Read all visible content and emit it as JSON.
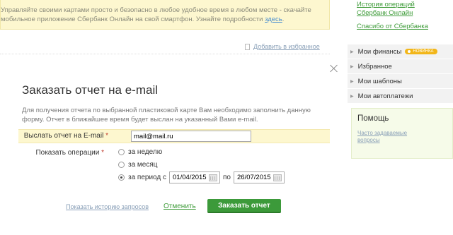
{
  "banner": {
    "line1": "Управляйте своими картами просто и безопасно в любое удобное время в любом месте - скачайте",
    "line2_text": "мобильное приложение Сбербанк Онлайн на свой смартфон. Узнайте подробности",
    "line2_link": "здесь",
    "line2_end": "."
  },
  "favorites_link": "Добавить в избранное",
  "sidebar": {
    "link1_line1": "История операций",
    "link1_line2": "Сбербанк Онлайн",
    "link2": "Спасибо от Сбербанка",
    "menu": [
      {
        "label": "Мои финансы",
        "badge": "НОВИНКА"
      },
      {
        "label": "Избранное"
      },
      {
        "label": "Мои шаблоны"
      },
      {
        "label": "Мои автоплатежи"
      }
    ],
    "help_title": "Помощь",
    "help_link_line1": "Часто задаваемые",
    "help_link_line2": "вопросы"
  },
  "modal": {
    "title": "Заказать отчет на e-mail",
    "description": "Для получения отчета по выбранной пластиковой карте Вам необходимо заполнить данную форму. Отчет в ближайшее время будет выслан на указанный Вами e-mail.",
    "email_label": "Выслать отчет на E-mail",
    "email_value": "mail@mail.ru",
    "required_mark": "*",
    "show_ops_label": "Показать операции",
    "option_week": "за неделю",
    "option_month": "за месяц",
    "option_period": "за период с",
    "date_from": "01/04/2015",
    "date_to_label": "по",
    "date_to": "26/07/2015",
    "history_link": "Показать историю запросов",
    "cancel": "Отменить",
    "submit": "Заказать отчет"
  }
}
